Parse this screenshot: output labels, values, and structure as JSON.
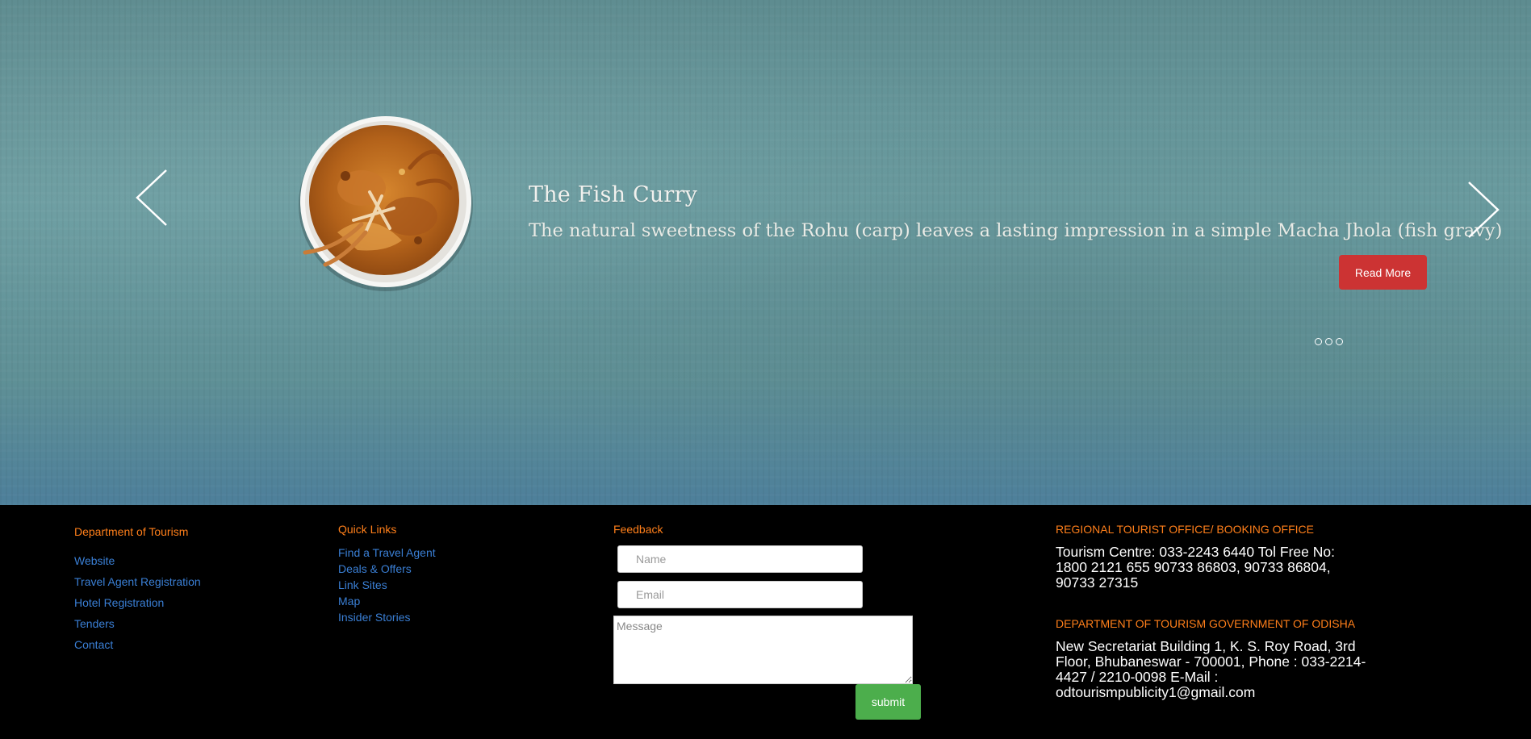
{
  "slider": {
    "title": "The Fish Curry",
    "description": "The natural sweetness of the Rohu (carp) leaves a lasting impression in a simple Macha Jhola (fish gravy)",
    "read_more_label": "Read More",
    "dot_count": 3,
    "icons": {
      "prev": "chevron-left-icon",
      "next": "chevron-right-icon"
    },
    "colors": {
      "read_more_bg": "#cc3333"
    }
  },
  "footer": {
    "department": {
      "title": "Department of Tourism",
      "links": [
        "Website",
        "Travel Agent Registration",
        "Hotel Registration",
        "Tenders",
        "Contact"
      ]
    },
    "quick_links": {
      "title": "Quick Links",
      "links": [
        "Find a Travel Agent",
        "Deals & Offers",
        "Link Sites",
        "Map",
        "Insider Stories"
      ]
    },
    "feedback": {
      "title": "Feedback",
      "name_placeholder": "Name",
      "email_placeholder": "Email",
      "message_placeholder": "Message",
      "submit_label": "submit"
    },
    "regional_office": {
      "title": "REGIONAL TOURIST OFFICE/ BOOKING OFFICE",
      "text": "Tourism Centre: 033-2243 6440 Tol Free No: 1800 2121 655 90733 86803, 90733 86804, 90733 27315"
    },
    "government_office": {
      "title": "DEPARTMENT OF TOURISM GOVERNMENT OF ODISHA",
      "text": "New Secretariat Building 1, K. S. Roy Road, 3rd Floor, Bhubaneswar - 700001, Phone : 033-2214-4427 / 2210-0098 E-Mail : odtourismpublicity1@gmail.com"
    },
    "colors": {
      "heading": "#ff7f1a",
      "link": "#3a7fd5",
      "submit_bg": "#4cae4c"
    }
  }
}
